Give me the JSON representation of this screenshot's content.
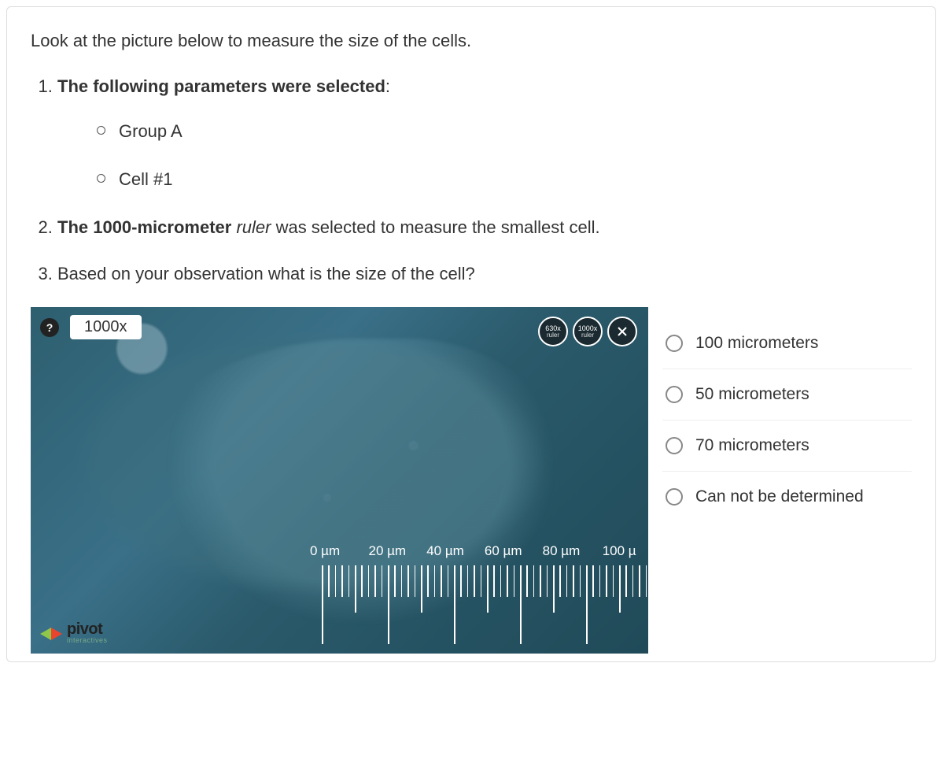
{
  "intro": "Look at the picture below to measure the size of the cells.",
  "steps": {
    "s1_bold": "The following parameters were selected",
    "s1_suffix": ":",
    "sub": [
      "Group A",
      "Cell #1"
    ],
    "s2_pre_bold": "The 1000-micrometer ",
    "s2_italic": "ruler",
    "s2_post": " was selected to measure the smallest cell.",
    "s3": "Based on your observation what is the size of the cell?"
  },
  "microscope": {
    "help": "?",
    "magnification": "1000x",
    "buttons": {
      "b1_top": "630x",
      "b1_bot": "ruler",
      "b2_top": "1000x",
      "b2_bot": "ruler"
    },
    "ruler_labels": [
      "0 µm",
      "20 µm",
      "40 µm",
      "60 µm",
      "80 µm",
      "100 µ"
    ],
    "logo": {
      "name": "pivot",
      "sub": "interactives"
    }
  },
  "answers": [
    "100 micrometers",
    "50 micrometers",
    "70 micrometers",
    "Can not be determined"
  ]
}
